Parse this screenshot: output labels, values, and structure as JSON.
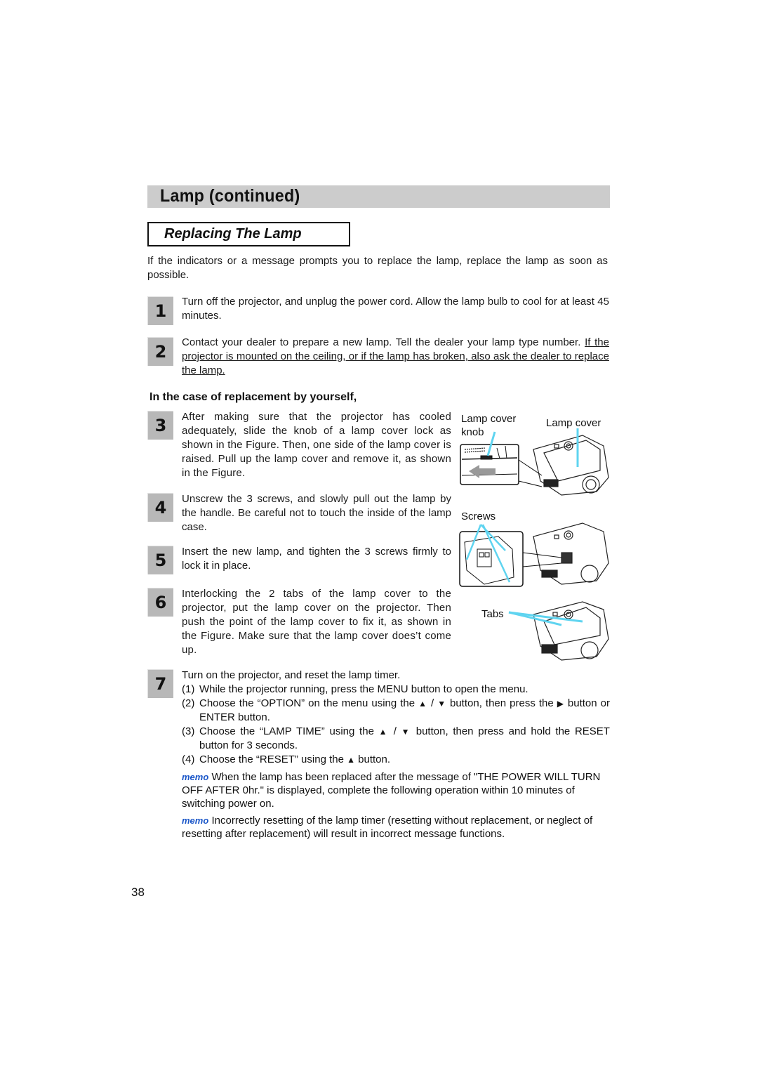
{
  "section_title": "Lamp (continued)",
  "subsection_title": "Replacing The Lamp",
  "intro": "If the indicators or a message prompts you to replace the lamp, replace the lamp as soon as possible.",
  "steps": [
    {
      "number": "1",
      "text": "Turn off the projector, and unplug the power cord. Allow the lamp bulb to cool for at least 45 minutes."
    },
    {
      "number": "2",
      "text": "Contact your dealer to prepare a new lamp. Tell the dealer your lamp type number.",
      "underlined_text": "If the projector is mounted on the ceiling, or if the lamp has broken, also ask the dealer to replace the lamp."
    },
    {
      "number": "3",
      "text": "After making sure that the projector has cooled adequately, slide the knob of a lamp cover lock as shown in the Figure. Then, one side of the lamp cover is raised. Pull up the lamp cover and remove it, as shown in the Figure."
    },
    {
      "number": "4",
      "text": "Unscrew the 3 screws, and slowly pull out the lamp by the handle. Be careful not to touch the inside of the lamp case."
    },
    {
      "number": "5",
      "text": "Insert the new lamp, and tighten the 3 screws firmly to lock it in place."
    },
    {
      "number": "6",
      "text": "Interlocking the 2 tabs of the lamp cover to the projector, put the lamp cover on the projector. Then push the point of the lamp cover to fix it, as shown in the Figure. Make sure that the lamp cover does’t come up."
    },
    {
      "number": "7",
      "text": "Turn on the projector, and reset the lamp timer."
    }
  ],
  "case_heading": "In the case of replacement by yourself,",
  "step7_items": [
    {
      "num": "(1)",
      "parts": [
        "While the projector running, press the MENU button to open the menu."
      ]
    },
    {
      "num": "(2)",
      "parts": [
        "Choose the “OPTION” on the menu using the ",
        " / ",
        " button, then press the ",
        " button or ENTER button."
      ]
    },
    {
      "num": "(3)",
      "parts": [
        "Choose the “LAMP TIME” using the ",
        " / ",
        " button, then press and hold the RESET button for 3 seconds."
      ]
    },
    {
      "num": "(4)",
      "parts": [
        "Choose the “RESET” using the ",
        " button."
      ]
    }
  ],
  "icons": {
    "up": "▲",
    "down": "▼",
    "right": "▶"
  },
  "figure_labels": {
    "lamp_cover_knob_1": "Lamp cover",
    "lamp_cover_knob_2": "knob",
    "lamp_cover": "Lamp cover",
    "screws": "Screws",
    "tabs": "Tabs"
  },
  "memos": [
    {
      "label": "memo",
      "text": "When the lamp has been replaced after the message of \"THE POWER WILL TURN OFF AFTER 0hr.\" is displayed, complete the following operation within 10 minutes of switching power on."
    },
    {
      "label": "memo",
      "text": "Incorrectly resetting of the lamp timer (resetting without replacement, or neglect of resetting after replacement) will result in incorrect message functions."
    }
  ],
  "page_number": "38",
  "colors": {
    "callout": "#5fd4f0",
    "memo": "#1a56c8",
    "header_bar": "#cccccc",
    "step_badge": "#b8b8b8"
  }
}
